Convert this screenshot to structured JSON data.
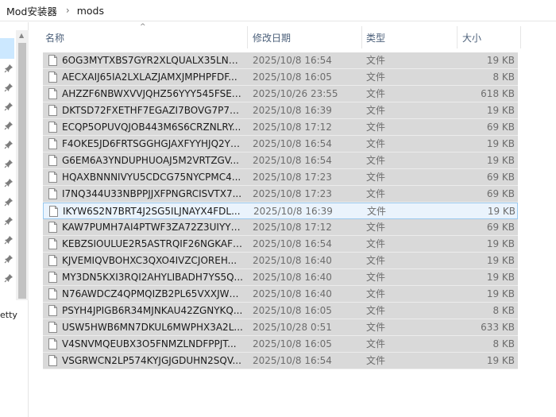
{
  "breadcrumb": {
    "parts": [
      "Mod安装器",
      "mods"
    ]
  },
  "nav": {
    "partial_text": "etty"
  },
  "columns": {
    "name": "名称",
    "date": "修改日期",
    "type": "类型",
    "size": "大小"
  },
  "files": [
    {
      "name": "6OG3MYTXBS7GYR2XLQUALX35LNR...",
      "date": "2025/10/8 16:54",
      "type": "文件",
      "size": "19 KB"
    },
    {
      "name": "AECXAIJ65IA2LXLAZJAMXJMPHPFDF...",
      "date": "2025/10/8 16:05",
      "type": "文件",
      "size": "8 KB"
    },
    {
      "name": "AHZZF6NBWXVVJQHZ56YYY545FSEY...",
      "date": "2025/10/26 23:55",
      "type": "文件",
      "size": "618 KB"
    },
    {
      "name": "DKTSD72FXETHF7EGAZI7BOVG7P7G...",
      "date": "2025/10/8 16:39",
      "type": "文件",
      "size": "19 KB"
    },
    {
      "name": "ECQP5OPUVQJOB443M6S6CRZNLRY...",
      "date": "2025/10/8 17:12",
      "type": "文件",
      "size": "69 KB"
    },
    {
      "name": "F4OKE5JD6FRTSGGHGJAXFYYHJQ2YX...",
      "date": "2025/10/8 16:54",
      "type": "文件",
      "size": "19 KB"
    },
    {
      "name": "G6EM6A3YNDUPHUOAJ5M2VRTZGV...",
      "date": "2025/10/8 16:54",
      "type": "文件",
      "size": "19 KB"
    },
    {
      "name": "HQAXBNNNIVYU5CDCG75NYCPMC4...",
      "date": "2025/10/8 17:23",
      "type": "文件",
      "size": "69 KB"
    },
    {
      "name": "I7NQ344U33NBPPJJXFPNGRCISVTX7...",
      "date": "2025/10/8 17:23",
      "type": "文件",
      "size": "69 KB"
    },
    {
      "name": "IKYW6S2N7BRT4J2SG5ILJNAYX4FDL...",
      "date": "2025/10/8 16:39",
      "type": "文件",
      "size": "19 KB"
    },
    {
      "name": "KAW7PUMH7AI4PTWF3ZA72Z3UIYYF...",
      "date": "2025/10/8 17:12",
      "type": "文件",
      "size": "69 KB"
    },
    {
      "name": "KEBZSIOULUE2R5ASTRQIF26NGKAFL...",
      "date": "2025/10/8 16:54",
      "type": "文件",
      "size": "19 KB"
    },
    {
      "name": "KJVEMIQVBOHXC3QXO4IVZCJOREH...",
      "date": "2025/10/8 16:40",
      "type": "文件",
      "size": "19 KB"
    },
    {
      "name": "MY3DN5KXI3RQI2AHYLIBADH7YS5Q...",
      "date": "2025/10/8 16:40",
      "type": "文件",
      "size": "19 KB"
    },
    {
      "name": "N76AWDCZ4QPMQIZB2PL65VXXJWB...",
      "date": "2025/10/8 16:40",
      "type": "文件",
      "size": "19 KB"
    },
    {
      "name": "PSYH4JPIGB6R34MJNKAU42ZGNYKQ...",
      "date": "2025/10/8 16:05",
      "type": "文件",
      "size": "8 KB"
    },
    {
      "name": "USW5HWB6MN7DKUL6MWPHX3A2L...",
      "date": "2025/10/28 0:51",
      "type": "文件",
      "size": "633 KB"
    },
    {
      "name": "V4SNVMQEUBX3O5FNMZLNDFPPJT...",
      "date": "2025/10/8 16:05",
      "type": "文件",
      "size": "8 KB"
    },
    {
      "name": "VSGRWCN2LP574KYJGJGDUHN2SQV...",
      "date": "2025/10/8 16:54",
      "type": "文件",
      "size": "19 KB"
    }
  ],
  "focused_index": 9,
  "colors": {
    "selected_row": "#d9d9d9",
    "focused_row": "#eaf3fc",
    "focused_border": "#99c9ef",
    "nav_selected": "#cce8ff",
    "header_text": "#4c607a"
  }
}
